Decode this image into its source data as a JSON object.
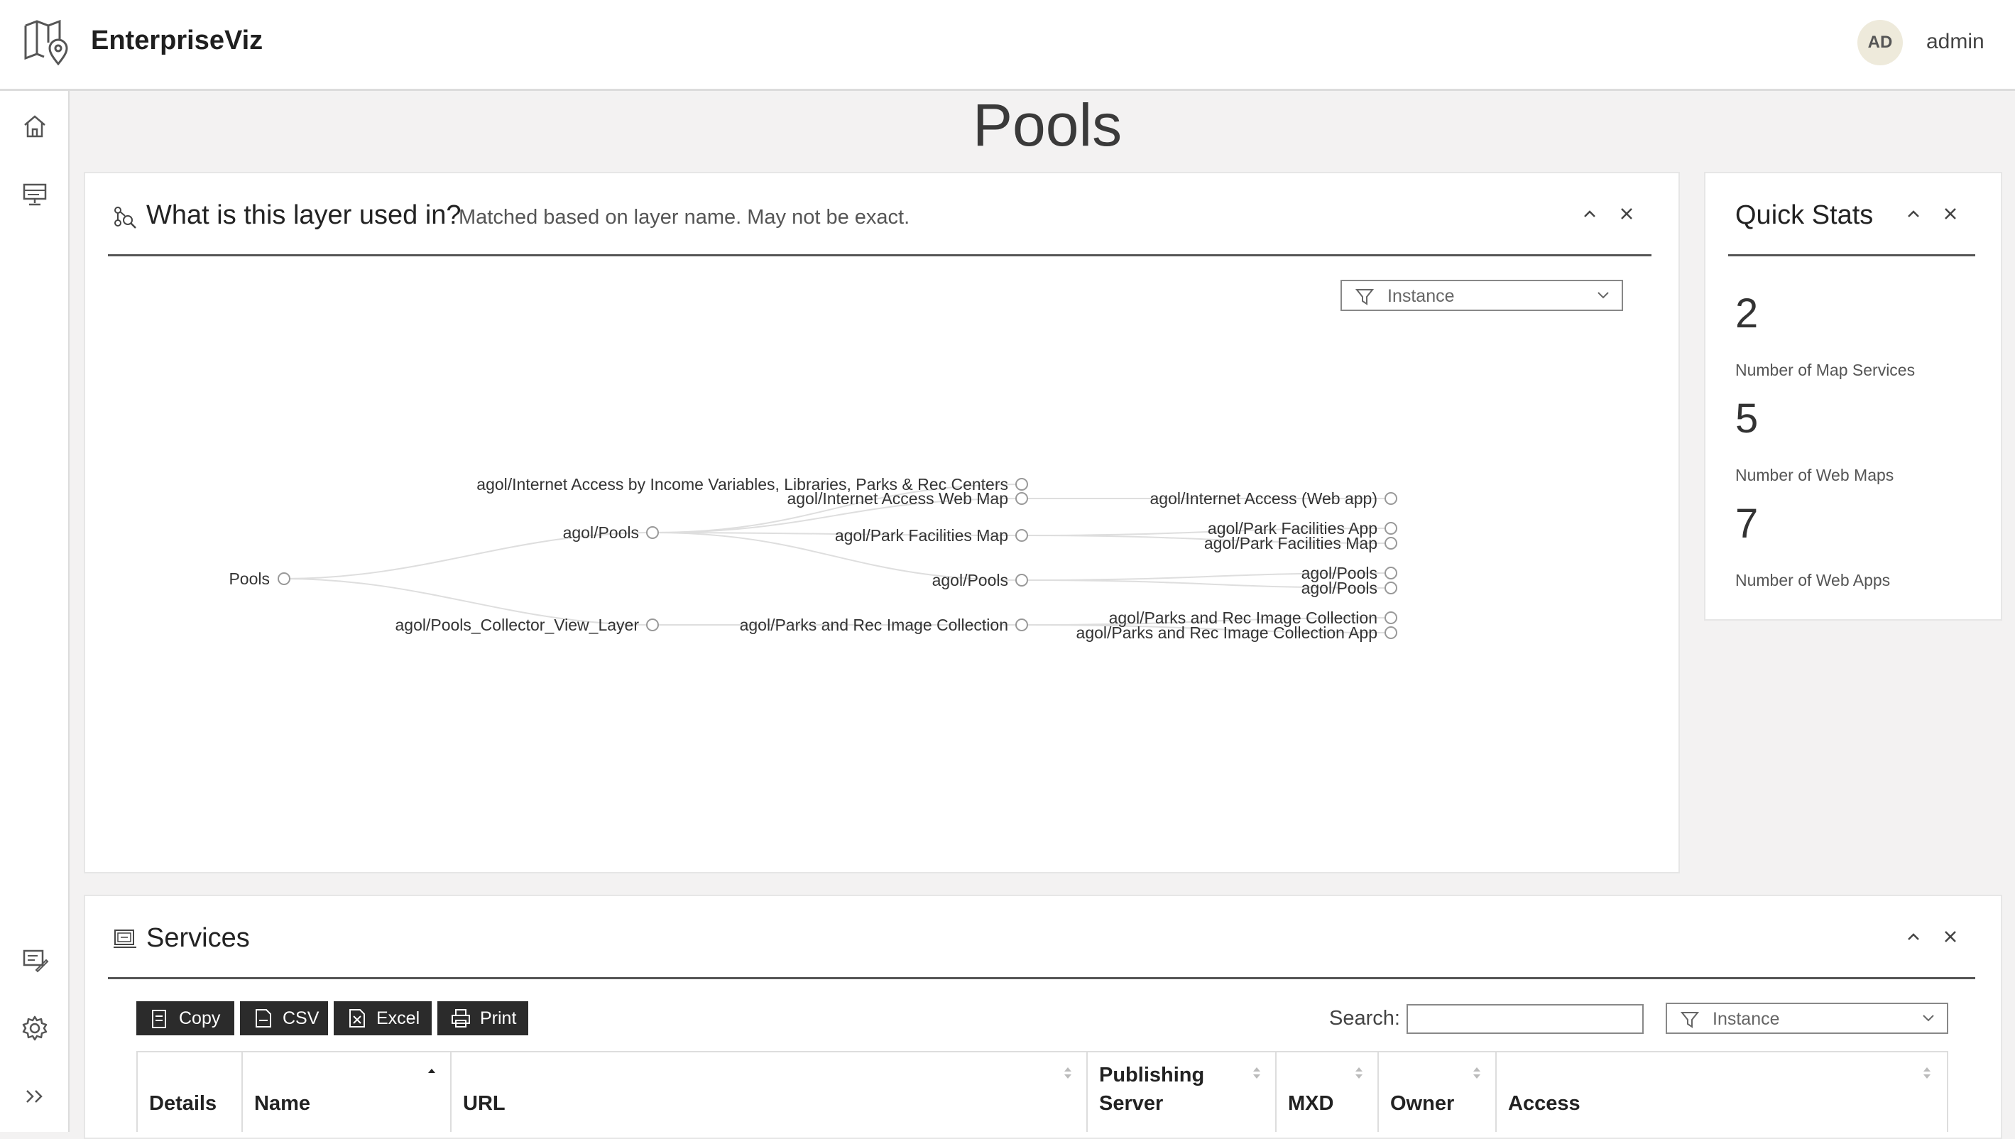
{
  "app": {
    "title": "EnterpriseViz",
    "avatar_initials": "AD",
    "username": "admin"
  },
  "page": {
    "title": "Pools"
  },
  "layer_usage": {
    "title": "What is this layer used in?",
    "note": "Matched based on layer name. May not be exact.",
    "filter_placeholder": "Instance",
    "tree": {
      "root": "Pools",
      "level1": [
        "agol/Pools",
        "agol/Pools_Collector_View_Layer"
      ],
      "level2": [
        "agol/Internet Access by Income Variables, Libraries, Parks & Rec Centers",
        "agol/Internet Access Web Map",
        "agol/Park Facilities Map",
        "agol/Pools",
        "agol/Parks and Rec Image Collection"
      ],
      "level3": [
        "agol/Internet Access (Web app)",
        "agol/Park Facilities App",
        "agol/Park Facilities Map",
        "agol/Pools",
        "agol/Pools",
        "agol/Parks and Rec Image Collection",
        "agol/Parks and Rec Image Collection App"
      ]
    }
  },
  "quick_stats": {
    "title": "Quick Stats",
    "items": [
      {
        "value": "2",
        "label": "Number of Map Services"
      },
      {
        "value": "5",
        "label": "Number of Web Maps"
      },
      {
        "value": "7",
        "label": "Number of Web Apps"
      }
    ]
  },
  "services": {
    "title": "Services",
    "buttons": {
      "copy": "Copy",
      "csv": "CSV",
      "excel": "Excel",
      "print": "Print"
    },
    "search_label": "Search:",
    "filter_placeholder": "Instance",
    "columns": [
      "Details",
      "Name",
      "URL",
      "Publishing Server",
      "MXD",
      "Owner",
      "Access"
    ]
  },
  "icons": {
    "logo": "map-pin-icon",
    "sidebar": [
      "home-icon",
      "server-icon",
      "edit-list-icon",
      "gear-icon",
      "expand-icon"
    ]
  },
  "colors": {
    "accent": "#2b2b2b",
    "background": "#f3f2f2",
    "avatar_bg": "#eeeadb"
  }
}
